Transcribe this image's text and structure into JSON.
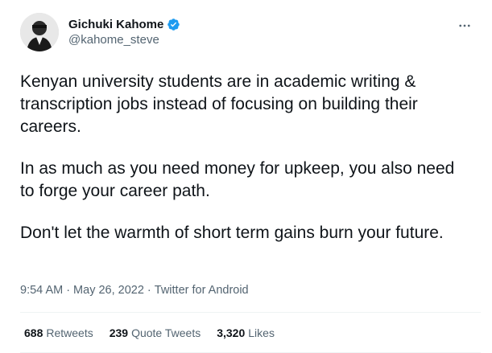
{
  "author": {
    "display_name": "Gichuki Kahome",
    "handle": "@kahome_steve",
    "verified": true,
    "verified_color": "#1d9bf0"
  },
  "more_icon": "more-horizontal-icon",
  "tweet": {
    "paragraphs": [
      "Kenyan university students are in academic writing & transcription jobs instead of focusing on building their careers.",
      "In as much as you need money for upkeep, you also need to forge your career path.",
      "Don't let the warmth of short term gains burn your future."
    ]
  },
  "meta": {
    "time": "9:54 AM",
    "date": "May 26, 2022",
    "source": "Twitter for Android",
    "separator": "·"
  },
  "stats": {
    "retweets": {
      "count": "688",
      "label": "Retweets"
    },
    "quote_tweets": {
      "count": "239",
      "label": "Quote Tweets"
    },
    "likes": {
      "count": "3,320",
      "label": "Likes"
    }
  }
}
